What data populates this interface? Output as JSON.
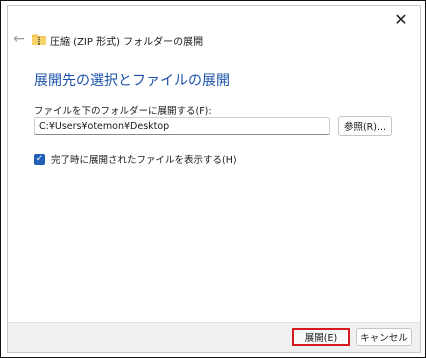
{
  "window": {
    "title": "圧縮 (ZIP 形式) フォルダーの展開",
    "close_glyph": "✕",
    "back_glyph": "←"
  },
  "main": {
    "heading": "展開先の選択とファイルの展開",
    "field_label": "ファイルを下のフォルダーに展開する(F):",
    "path_value": "C:¥Users¥otemon¥Desktop",
    "browse_label": "参照(R)...",
    "checkbox_label": "完了時に展開されたファイルを表示する(H)",
    "checkbox_checked": true
  },
  "footer": {
    "extract_label": "展開(E)",
    "cancel_label": "キャンセル"
  },
  "colors": {
    "heading_blue": "#1b52a8",
    "checkbox_blue": "#1f5fb8",
    "highlight_red": "#d71920",
    "folder_yellow": "#f2c24e"
  },
  "icons": {
    "folder": "zip-folder-icon",
    "back": "back-arrow-icon",
    "close": "close-icon",
    "check": "checkmark-icon"
  }
}
